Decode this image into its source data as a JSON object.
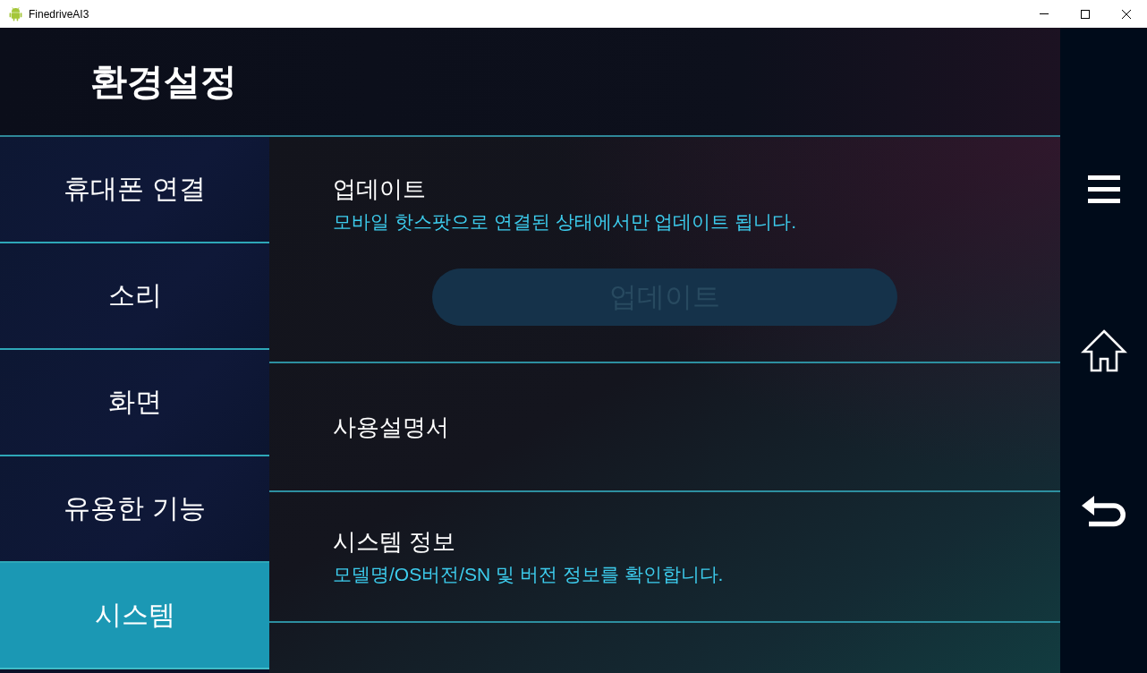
{
  "window": {
    "title": "FinedriveAI3"
  },
  "header": {
    "title": "환경설정"
  },
  "sidebar": {
    "items": [
      {
        "label": "휴대폰 연결",
        "selected": false
      },
      {
        "label": "소리",
        "selected": false
      },
      {
        "label": "화면",
        "selected": false
      },
      {
        "label": "유용한 기능",
        "selected": false
      },
      {
        "label": "시스템",
        "selected": true
      }
    ]
  },
  "sections": [
    {
      "title": "업데이트",
      "description": "모바일 핫스팟으로 연결된 상태에서만 업데이트 됩니다.",
      "button": {
        "label": "업데이트",
        "disabled": true
      }
    },
    {
      "title": "사용설명서"
    },
    {
      "title": "시스템 정보",
      "description": "모델명/OS버전/SN 및 버전 정보를 확인합니다."
    }
  ]
}
